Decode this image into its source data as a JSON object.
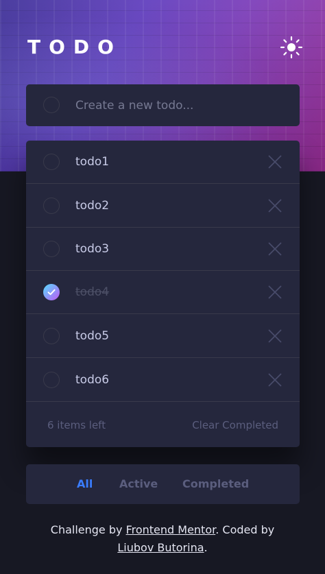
{
  "header": {
    "logo": "TODO",
    "theme_toggle_icon": "sun-icon"
  },
  "new_todo": {
    "placeholder": "Create a new todo..."
  },
  "todos": [
    {
      "label": "todo1",
      "completed": false
    },
    {
      "label": "todo2",
      "completed": false
    },
    {
      "label": "todo3",
      "completed": false
    },
    {
      "label": "todo4",
      "completed": true
    },
    {
      "label": "todo5",
      "completed": false
    },
    {
      "label": "todo6",
      "completed": false
    }
  ],
  "footer": {
    "items_left": "6 items left",
    "clear_completed": "Clear Completed"
  },
  "filters": {
    "all": "All",
    "active": "Active",
    "completed": "Completed",
    "selected": "All"
  },
  "attribution": {
    "prefix": "Challenge by ",
    "link1": "Frontend Mentor",
    "middle": ". Coded by",
    "link2": "Liubov Butorina",
    "suffix": "."
  },
  "colors": {
    "page_background": "#171823",
    "card_background": "#25273d",
    "accent": "#3a7cfd",
    "check_gradient_start": "#55ddff",
    "check_gradient_end": "#c058f3",
    "text": "#c8cbe7",
    "muted_text": "#5b5e7e",
    "completed_text": "#4d5067"
  }
}
